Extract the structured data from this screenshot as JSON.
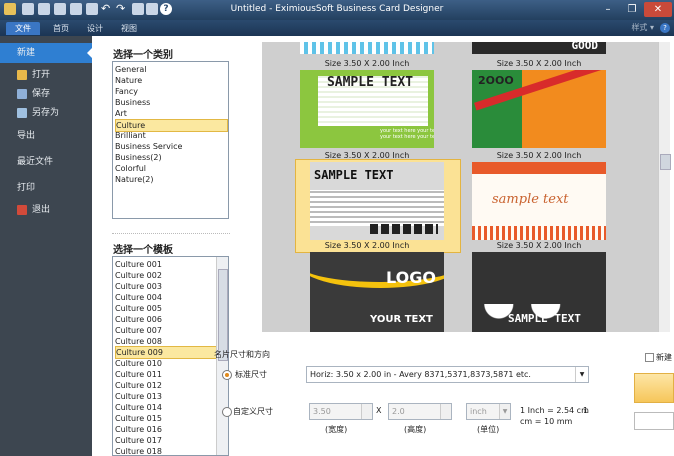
{
  "window": {
    "title": "Untitled - EximiousSoft Business Card Designer",
    "controls": [
      "–",
      "❐",
      "✕"
    ]
  },
  "ribbon": {
    "tabs": [
      "文件",
      "首页",
      "设计",
      "视图"
    ],
    "style_label": "样式 ▾",
    "help": "?"
  },
  "left_nav": {
    "items": [
      {
        "label": "新建",
        "icon": "new-icon"
      },
      {
        "label": "打开",
        "icon": "folder-open-icon"
      },
      {
        "label": "保存",
        "icon": "save-icon"
      },
      {
        "label": "另存为",
        "icon": "save-as-icon"
      },
      {
        "label": "导出",
        "icon": ""
      },
      {
        "label": "最近文件",
        "icon": ""
      },
      {
        "label": "打印",
        "icon": ""
      },
      {
        "label": "退出",
        "icon": "exit-icon"
      }
    ]
  },
  "categories": {
    "header": "选择一个类别",
    "items": [
      "General",
      "Nature",
      "Fancy",
      "Business",
      "Art",
      "Culture",
      "Brilliant",
      "Business Service",
      "Business(2)",
      "Colorful",
      "Nature(2)"
    ],
    "selected": "Culture"
  },
  "templates": {
    "header": "选择一个模板",
    "items": [
      "Culture 001",
      "Culture 002",
      "Culture 003",
      "Culture 004",
      "Culture 005",
      "Culture 006",
      "Culture 007",
      "Culture 008",
      "Culture 009",
      "Culture 010",
      "Culture 011",
      "Culture 012",
      "Culture 013",
      "Culture 014",
      "Culture 015",
      "Culture 016",
      "Culture 017",
      "Culture 018"
    ],
    "selected": "Culture 009"
  },
  "gallery": {
    "cards": [
      {
        "caption": "Size 3.50 X 2.00 Inch",
        "text": "GOOD"
      },
      {
        "caption": "Size 3.50 X 2.00 Inch",
        "text": ""
      },
      {
        "caption": "Size 3.50 X 2.00 Inch",
        "text": "SAMPLE TEXT",
        "sub": "your text here your text\nyour text here your text"
      },
      {
        "caption": "Size 3.50 X 2.00 Inch",
        "text": "2OOO"
      },
      {
        "caption": "Size 3.50 X 2.00 Inch",
        "text": "SAMPLE TEXT"
      },
      {
        "caption": "Size 3.50 X 2.00 Inch",
        "text": "sample text"
      },
      {
        "caption": "",
        "text": "LOGO",
        "sub": "YOUR TEXT"
      },
      {
        "caption": "",
        "text": "SAMPLE TEXT"
      }
    ]
  },
  "size_panel": {
    "header": "名片尺寸和方向",
    "standard_label": "标准尺寸",
    "standard_value": "Horiz: 3.50 x 2.00 in - Avery 8371,5371,8373,5871 etc.",
    "custom_label": "自定义尺寸",
    "width_value": "3.50",
    "height_value": "2.0",
    "x_sep": "X",
    "unit_value": "inch",
    "width_caption": "(宽度)",
    "height_caption": "(高度)",
    "unit_caption": "(单位)",
    "conversion_1": "1 Inch = 2.54 cm",
    "conversion_sep": "1",
    "conversion_2": "cm = 10 mm",
    "new_label": "新建"
  },
  "colors": {
    "accent": "#2f7fd2",
    "selection": "#fbe8a0",
    "nav_bg": "#3d4650",
    "titlebar": "#2b4a6e"
  }
}
